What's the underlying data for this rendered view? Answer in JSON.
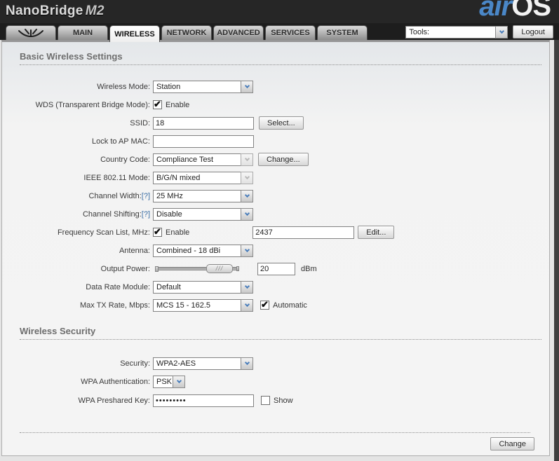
{
  "header": {
    "product": "NanoBridge",
    "model": "M2",
    "logo_air": "air",
    "logo_os": "OS"
  },
  "nav": {
    "tabs": [
      {
        "label": "MAIN"
      },
      {
        "label": "WIRELESS"
      },
      {
        "label": "NETWORK"
      },
      {
        "label": "ADVANCED"
      },
      {
        "label": "SERVICES"
      },
      {
        "label": "SYSTEM"
      }
    ],
    "tools_value": "Tools:",
    "logout_label": "Logout"
  },
  "basic": {
    "title": "Basic Wireless Settings",
    "wireless_mode": {
      "label": "Wireless Mode:",
      "value": "Station"
    },
    "wds": {
      "label": "WDS (Transparent Bridge Mode):",
      "option": "Enable",
      "checked": true
    },
    "ssid": {
      "label": "SSID:",
      "value": "18",
      "button": "Select..."
    },
    "lock_ap_mac": {
      "label": "Lock to AP MAC:",
      "value": ""
    },
    "country_code": {
      "label": "Country Code:",
      "value": "Compliance Test",
      "button": "Change...",
      "disabled": true
    },
    "ieee_mode": {
      "label": "IEEE 802.11 Mode:",
      "value": "B/G/N mixed",
      "disabled": true
    },
    "channel_width": {
      "label": "Channel Width:",
      "help": "[?]",
      "value": "25 MHz"
    },
    "channel_shifting": {
      "label": "Channel Shifting:",
      "help": "[?]",
      "value": "Disable"
    },
    "freq_scan": {
      "label": "Frequency Scan List, MHz:",
      "option": "Enable",
      "checked": true,
      "value": "2437",
      "button": "Edit..."
    },
    "antenna": {
      "label": "Antenna:",
      "value": "Combined - 18 dBi"
    },
    "output_power": {
      "label": "Output Power:",
      "value": "20",
      "unit": "dBm"
    },
    "data_rate_module": {
      "label": "Data Rate Module:",
      "value": "Default"
    },
    "max_tx_rate": {
      "label": "Max TX Rate, Mbps:",
      "value": "MCS 15 - 162.5",
      "option": "Automatic",
      "checked": true
    }
  },
  "security": {
    "title": "Wireless Security",
    "security": {
      "label": "Security:",
      "value": "WPA2-AES"
    },
    "wpa_auth": {
      "label": "WPA Authentication:",
      "value": "PSK"
    },
    "wpa_key": {
      "label": "WPA Preshared Key:",
      "value": "•••••••••",
      "option": "Show",
      "checked": false
    }
  },
  "footer": {
    "change_label": "Change"
  },
  "colors": {
    "accent_blue": "#4a87c7",
    "chevron_blue": "#4a7ebb",
    "header_bg": "#262626"
  }
}
